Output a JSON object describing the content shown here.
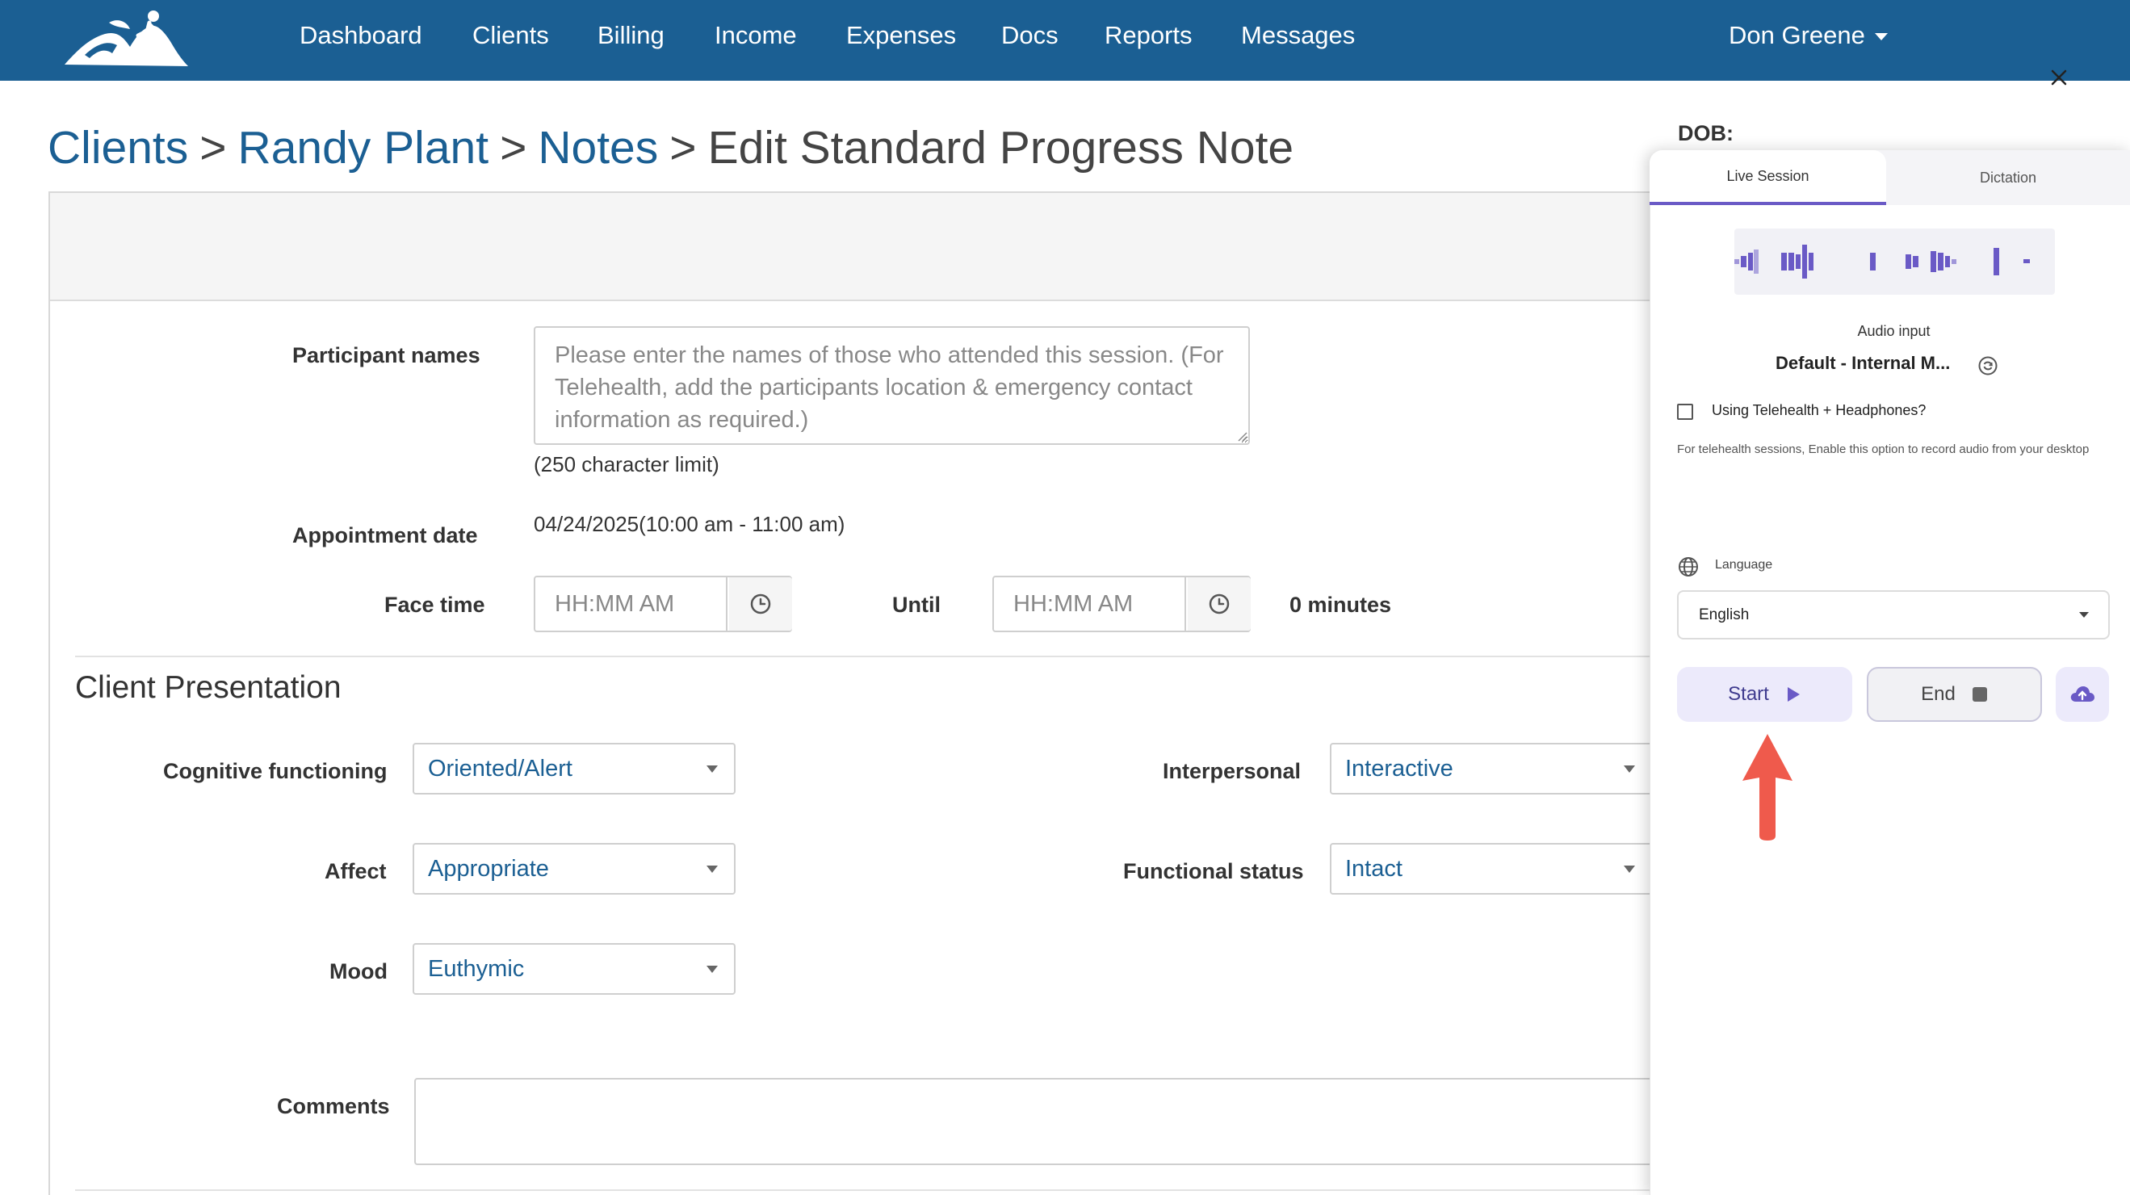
{
  "nav": {
    "items": [
      "Dashboard",
      "Clients",
      "Billing",
      "Income",
      "Expenses",
      "Docs",
      "Reports",
      "Messages"
    ],
    "user": "Don Greene"
  },
  "breadcrumb": {
    "clients": "Clients",
    "client_name": "Randy Plant",
    "notes": "Notes",
    "separator": ">",
    "current": "Edit Standard Progress Note"
  },
  "form": {
    "participant_label": "Participant names",
    "participant_placeholder": "Please enter the names of those who attended this session. (For Telehealth, add the participants location & emergency contact information as required.)",
    "char_limit": "(250 character limit)",
    "appointment_label": "Appointment date",
    "appointment_value": "04/24/2025(10:00 am - 11:00 am)",
    "face_time_label": "Face time",
    "face_time_placeholder": "HH:MM AM",
    "until_label": "Until",
    "until_placeholder": "HH:MM AM",
    "duration": "0 minutes",
    "section_title": "Client Presentation",
    "cognitive_label": "Cognitive functioning",
    "cognitive_value": "Oriented/Alert",
    "interpersonal_label": "Interpersonal",
    "interpersonal_value": "Interactive",
    "affect_label": "Affect",
    "affect_value": "Appropriate",
    "functional_label": "Functional status",
    "functional_value": "Intact",
    "mood_label": "Mood",
    "mood_value": "Euthymic",
    "comments_label": "Comments"
  },
  "panel": {
    "dob_label": "DOB:",
    "tab_live": "Live Session",
    "tab_dictation": "Dictation",
    "audio_input_label": "Audio input",
    "audio_device": "Default - Internal M...",
    "telehealth_label": "Using Telehealth + Headphones?",
    "telehealth_help": "For telehealth sessions, Enable this option to record audio from your desktop",
    "language_label": "Language",
    "language_value": "English",
    "start_label": "Start",
    "end_label": "End"
  },
  "colors": {
    "nav_bg": "#1b5f93",
    "link": "#1b5f93",
    "accent": "#6a5ac6",
    "annotation_arrow": "#ef5a4c"
  },
  "icons": [
    "logo-icon",
    "caret-down-icon",
    "clock-icon",
    "close-icon",
    "waveform-icon",
    "refresh-icon",
    "globe-icon",
    "play-icon",
    "stop-icon",
    "cloud-upload-icon",
    "red-arrow-annotation"
  ]
}
